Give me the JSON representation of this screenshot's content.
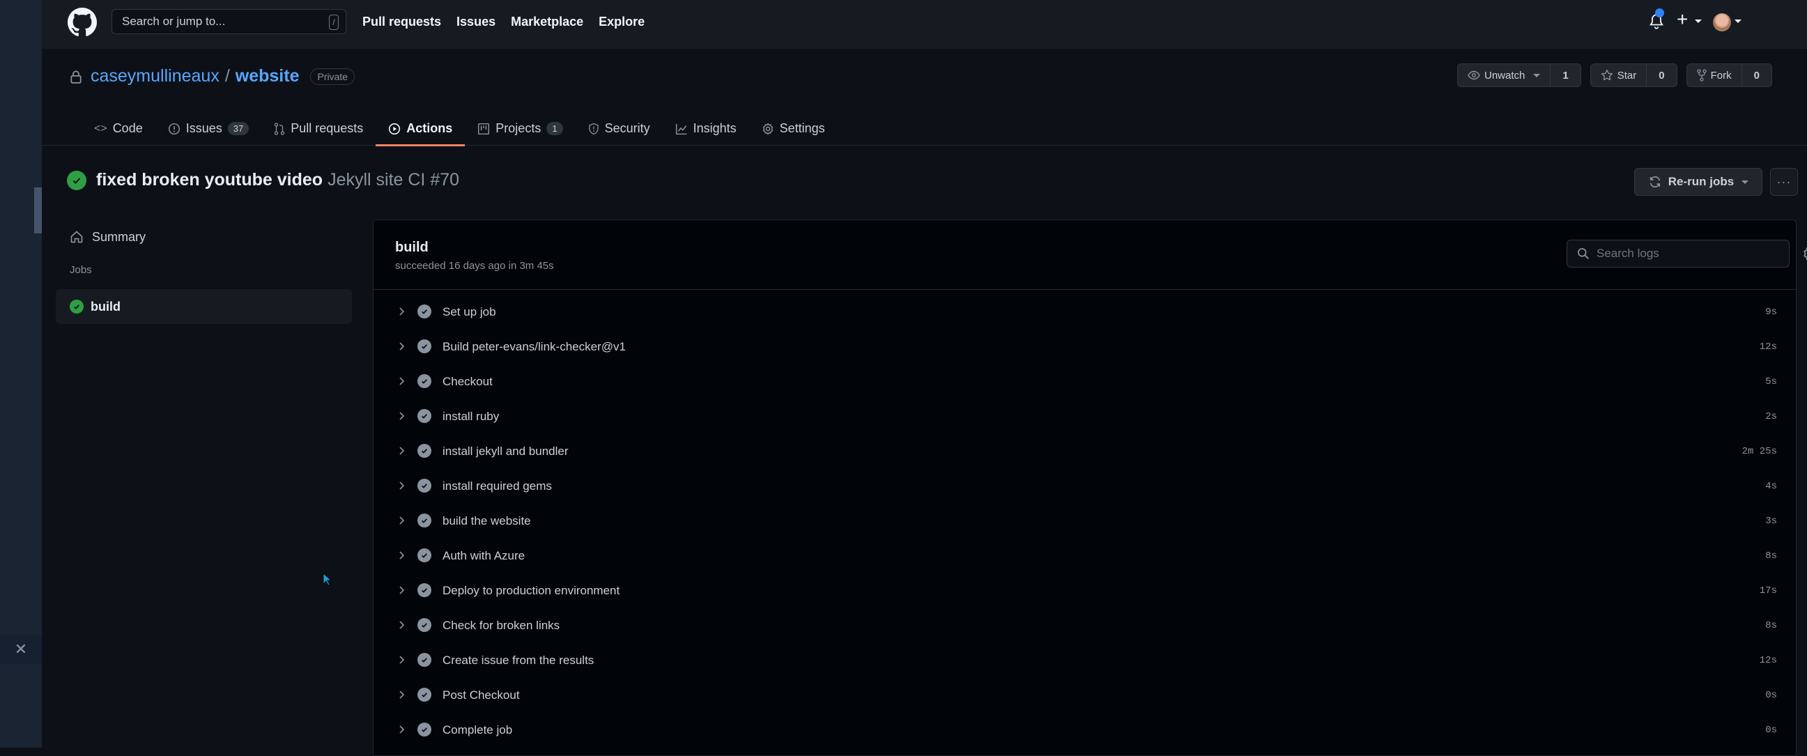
{
  "side_strip": {
    "close_icon": "close-icon"
  },
  "header": {
    "search_placeholder": "Search or jump to...",
    "search_shortcut": "/",
    "nav": [
      "Pull requests",
      "Issues",
      "Marketplace",
      "Explore"
    ],
    "notification_unread": true,
    "accent_color": "#2f81f7"
  },
  "repo": {
    "owner": "caseymullineaux",
    "separator": "/",
    "name": "website",
    "visibility": "Private",
    "watch": {
      "label": "Unwatch",
      "count": "1"
    },
    "star": {
      "label": "Star",
      "count": "0"
    },
    "fork": {
      "label": "Fork",
      "count": "0"
    }
  },
  "tabs": [
    {
      "label": "Code",
      "icon": "code-icon"
    },
    {
      "label": "Issues",
      "count": "37",
      "icon": "issue-opened-icon"
    },
    {
      "label": "Pull requests",
      "icon": "git-pull-request-icon"
    },
    {
      "label": "Actions",
      "icon": "play-icon",
      "active": true
    },
    {
      "label": "Projects",
      "count": "1",
      "icon": "project-icon"
    },
    {
      "label": "Security",
      "icon": "shield-icon"
    },
    {
      "label": "Insights",
      "icon": "graph-icon"
    },
    {
      "label": "Settings",
      "icon": "gear-icon"
    }
  ],
  "run": {
    "commit_message": "fixed broken youtube video",
    "workflow": "Jekyll site CI #70",
    "status": "success",
    "rerun_label": "Re-run jobs",
    "more_label": "···"
  },
  "sidebar": {
    "summary_label": "Summary",
    "jobs_heading": "Jobs",
    "jobs": [
      {
        "name": "build",
        "status": "success"
      }
    ]
  },
  "job": {
    "name": "build",
    "status_text": "succeeded 16 days ago in 3m 45s",
    "search_placeholder": "Search logs",
    "steps": [
      {
        "name": "Set up job",
        "duration": "9s"
      },
      {
        "name": "Build peter-evans/link-checker@v1",
        "duration": "12s"
      },
      {
        "name": "Checkout",
        "duration": "5s"
      },
      {
        "name": "install ruby",
        "duration": "2s"
      },
      {
        "name": "install jekyll and bundler",
        "duration": "2m 25s"
      },
      {
        "name": "install required gems",
        "duration": "4s"
      },
      {
        "name": "build the website",
        "duration": "3s"
      },
      {
        "name": "Auth with Azure",
        "duration": "8s"
      },
      {
        "name": "Deploy to production environment",
        "duration": "17s"
      },
      {
        "name": "Check for broken links",
        "duration": "8s"
      },
      {
        "name": "Create issue from the results",
        "duration": "12s"
      },
      {
        "name": "Post Checkout",
        "duration": "0s"
      },
      {
        "name": "Complete job",
        "duration": "0s"
      }
    ]
  },
  "colors": {
    "success": "#2ea043",
    "link": "#58a6ff",
    "active_tab_underline": "#f78166"
  }
}
